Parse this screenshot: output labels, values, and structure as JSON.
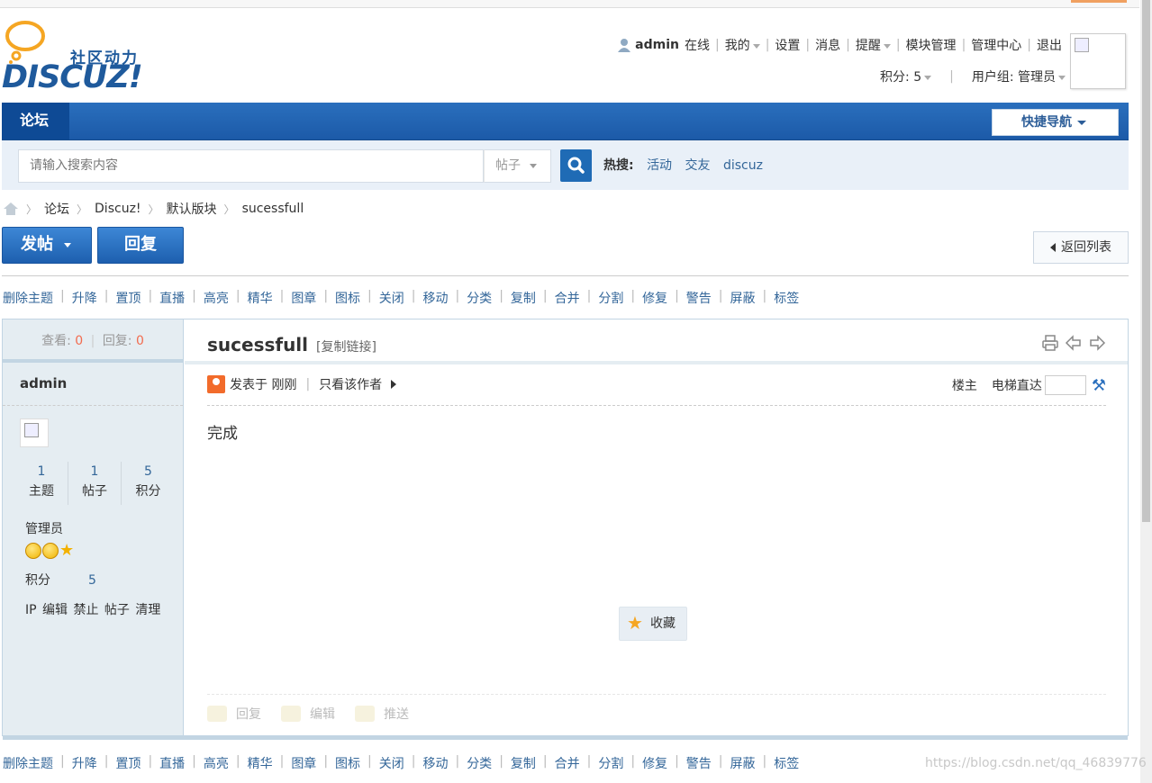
{
  "logo": {
    "cn": "社区动力",
    "en": "DISCUZ!"
  },
  "user_menu": {
    "username": "admin",
    "status": "在线",
    "items": [
      "我的",
      "设置",
      "消息",
      "提醒",
      "模块管理",
      "管理中心",
      "退出"
    ],
    "points_label": "积分: 5",
    "group_label": "用户组: 管理员"
  },
  "nav": {
    "forum": "论坛",
    "quick_nav": "快捷导航"
  },
  "search": {
    "placeholder": "请输入搜索内容",
    "type": "帖子",
    "hot_label": "热搜:",
    "hot_terms": [
      "活动",
      "交友",
      "discuz"
    ]
  },
  "breadcrumb": [
    "论坛",
    "Discuz!",
    "默认版块",
    "sucessfull"
  ],
  "buttons": {
    "post": "发帖",
    "reply": "回复",
    "back": "返回列表"
  },
  "mod_actions": [
    "删除主题",
    "升降",
    "置顶",
    "直播",
    "高亮",
    "精华",
    "图章",
    "图标",
    "关闭",
    "移动",
    "分类",
    "复制",
    "合并",
    "分割",
    "修复",
    "警告",
    "屏蔽",
    "标签"
  ],
  "thread": {
    "views_label": "查看:",
    "views": "0",
    "replies_label": "回复:",
    "replies": "0",
    "title": "sucessfull",
    "copy_link": "[复制链接]",
    "posted": "发表于 刚刚",
    "only_author": "只看该作者",
    "floor": "楼主",
    "elevator": "电梯直达",
    "content": "完成",
    "favorite": "收藏",
    "actions": [
      "回复",
      "编辑",
      "推送"
    ]
  },
  "author": {
    "name": "admin",
    "counts": [
      {
        "num": "1",
        "label": "主题"
      },
      {
        "num": "1",
        "label": "帖子"
      },
      {
        "num": "5",
        "label": "积分"
      }
    ],
    "group": "管理员",
    "score_label": "积分",
    "score": "5",
    "ops": "IP 编辑 禁止 帖子 清理"
  },
  "watermark": "https://blog.csdn.net/qq_46839776"
}
